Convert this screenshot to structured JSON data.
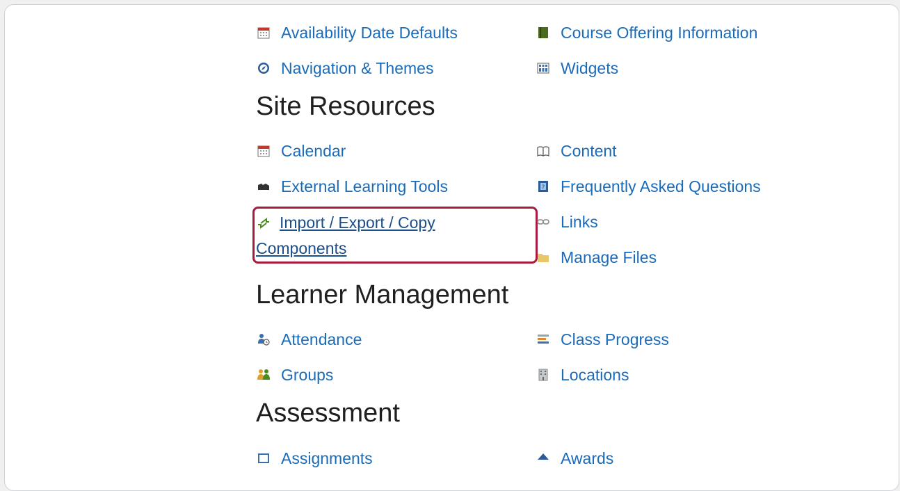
{
  "sections": {
    "site_resources": "Site Resources",
    "learner_management": "Learner Management",
    "assessment": "Assessment"
  },
  "top_links": {
    "availability": "Availability Date Defaults",
    "course_offering": "Course Offering Information",
    "navigation": "Navigation & Themes",
    "widgets": "Widgets"
  },
  "site_links": {
    "calendar": "Calendar",
    "content": "Content",
    "external_tools": "External Learning Tools",
    "faq": "Frequently Asked Questions",
    "import_line1": "Import / Export / Copy",
    "import_line2": "Components",
    "links": "Links",
    "manage_files": "Manage Files"
  },
  "learner_links": {
    "attendance": "Attendance",
    "class_progress": "Class Progress",
    "groups": "Groups",
    "locations": "Locations"
  },
  "assessment_links": {
    "assignments": "Assignments",
    "awards": "Awards"
  },
  "colors": {
    "link": "#1b6bb8",
    "highlight": "#a61b3e"
  }
}
